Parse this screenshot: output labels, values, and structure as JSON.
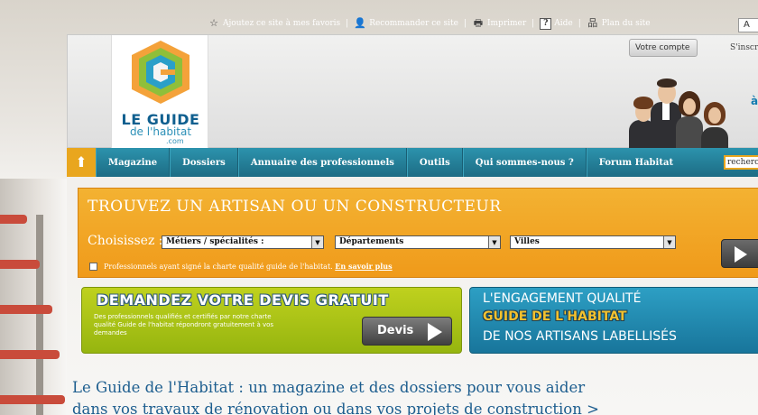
{
  "toolbar": {
    "favorites": "Ajoutez ce site à mes favoris",
    "recommend": "Recommander ce site",
    "print": "Imprimer",
    "help": "Aide",
    "sitemap": "Plan du site",
    "font_size_button": "A"
  },
  "logo": {
    "line1": "LE GUIDE",
    "line2": "de l'habitat",
    "line3": ".com"
  },
  "account": {
    "button": "Votre compte",
    "signin": "S'inscri",
    "side_text": "à"
  },
  "nav": {
    "items": [
      "Magazine",
      "Dossiers",
      "Annuaire des professionnels",
      "Outils",
      "Qui sommes-nous ?",
      "Forum Habitat"
    ],
    "search_value": "recherc"
  },
  "finder": {
    "title": "TROUVEZ UN ARTISAN OU UN CONSTRUCTEUR",
    "choose_label": "Choisissez :",
    "select_trades": "Métiers / spécialités :",
    "select_departments": "Départements",
    "select_cities": "Villes",
    "note": "Professionnels ayant signé la charte qualité guide de l'habitat.",
    "note_link": "En savoir plus"
  },
  "devis": {
    "title": "DEMANDEZ VOTRE DEVIS GRATUIT",
    "text": "Des professionnels qualifiés et certifiés par notre charte qualité Guide de l'habitat répondront gratuitement à vos demandes",
    "button": "Devis"
  },
  "engagement": {
    "line1": "L'ENGAGEMENT QUALITÉ",
    "line2": "GUIDE DE L'HABITAT",
    "line3": "DE NOS ARTISANS LABELLISÉS"
  },
  "intro": {
    "line1": "Le Guide de l'Habitat : un magazine et des dossiers pour vous aider",
    "line2": "dans vos travaux de rénovation ou dans vos projets de construction >"
  },
  "colors": {
    "nav": "#1d7f99",
    "home": "#e9a61e",
    "finder": "#f2a524",
    "devis": "#abc51a",
    "engagement": "#2289b0",
    "intro_text": "#1d5e8f"
  }
}
